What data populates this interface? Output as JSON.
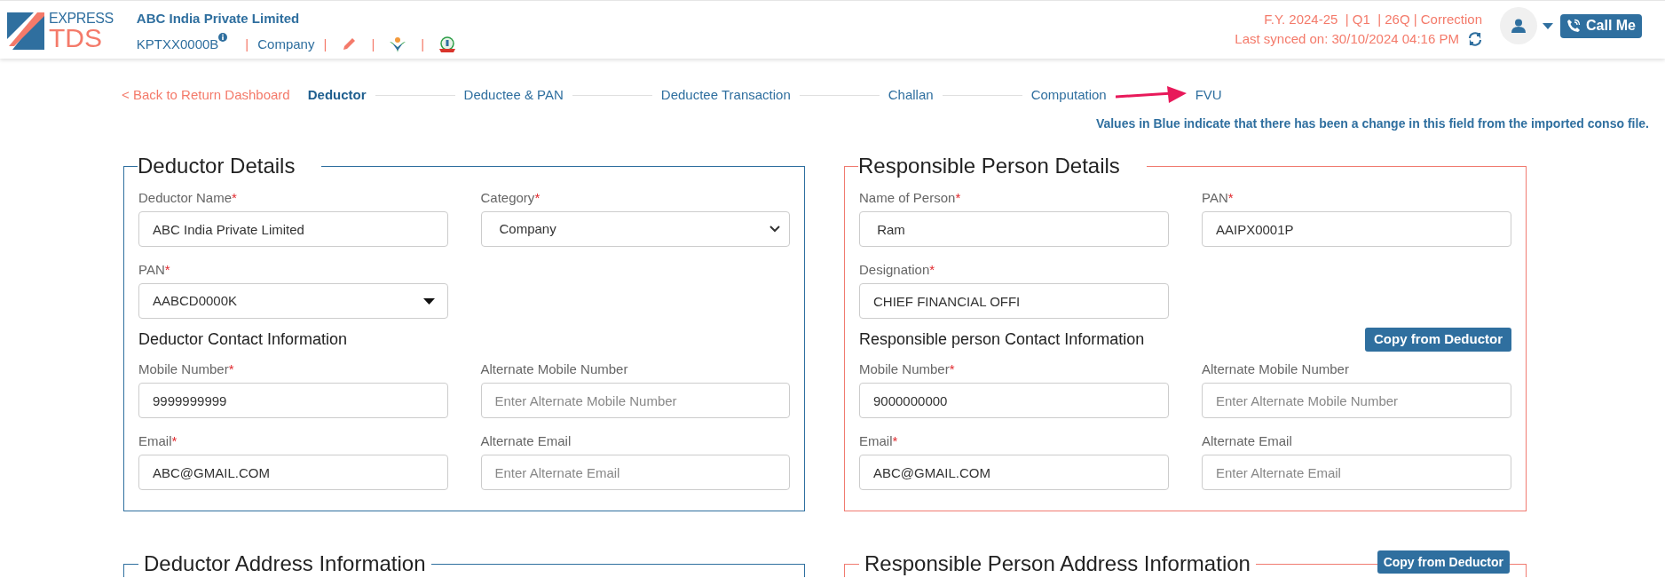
{
  "header": {
    "logo": {
      "line1": "EXPRESS",
      "line2": "TDS"
    },
    "company_name": "ABC India Private Limited",
    "meta_items": [
      {
        "kind": "tan",
        "text": "KPTXX0000B"
      },
      {
        "kind": "separator",
        "text": "|"
      },
      {
        "kind": "label",
        "text": "Company"
      },
      {
        "kind": "separator",
        "text": "|"
      },
      {
        "kind": "edit"
      },
      {
        "kind": "separator",
        "text": "|"
      },
      {
        "kind": "emblem"
      },
      {
        "kind": "separator",
        "text": "|"
      },
      {
        "kind": "seal"
      }
    ],
    "return_info": "F.Y. 2024-25  | Q1  | 26Q | Correction",
    "last_synced": "Last synced on: 30/10/2024 04:16 PM",
    "call_button": "Call Me"
  },
  "back_link": "< Back to Return Dashboard",
  "steps": [
    {
      "label": "Deductor",
      "selected": true
    },
    {
      "label": "Deductee & PAN",
      "selected": false
    },
    {
      "label": "Deductee Transaction",
      "selected": false
    },
    {
      "label": "Challan",
      "selected": false
    },
    {
      "label": "Computation",
      "selected": false
    },
    {
      "label": "FVU",
      "selected": false
    }
  ],
  "note": "Values in Blue indicate that there has been a change in this field from the imported conso file.",
  "sections": [
    {
      "title": "Deductor Details",
      "kind": "deductor",
      "items": [
        {
          "kind": "fields",
          "fields": [
            {
              "label": "Deductor Name",
              "required_mark": "*",
              "kind": "text",
              "value": "ABC India Private Limited"
            },
            {
              "label": "Category",
              "required_mark": "*",
              "kind": "select",
              "value": "Company"
            }
          ]
        },
        {
          "kind": "fields",
          "fields": [
            {
              "label": "PAN",
              "required_mark": "*",
              "kind": "dropdown",
              "value": "AABCD0000K"
            }
          ]
        },
        {
          "kind": "heading",
          "text": "Deductor Contact Information"
        },
        {
          "kind": "fields",
          "fields": [
            {
              "label": "Mobile Number",
              "required_mark": "*",
              "kind": "text",
              "value": "9999999999"
            },
            {
              "label": "Alternate Mobile Number",
              "kind": "text",
              "placeholder": "Enter Alternate Mobile Number"
            }
          ]
        },
        {
          "kind": "fields",
          "fields": [
            {
              "label": "Email",
              "required_mark": "*",
              "kind": "text",
              "value": "ABC@GMAIL.COM"
            },
            {
              "label": "Alternate Email",
              "kind": "text",
              "placeholder": "Enter Alternate Email"
            }
          ]
        }
      ]
    },
    {
      "title": "Responsible Person Details",
      "kind": "responsible",
      "items": [
        {
          "kind": "fields",
          "fields": [
            {
              "label": "Name of Person",
              "required_mark": "*",
              "kind": "text",
              "value": " Ram"
            },
            {
              "label": "PAN",
              "required_mark": "*",
              "kind": "text",
              "value": "AAIPX0001P"
            }
          ]
        },
        {
          "kind": "fields",
          "fields": [
            {
              "label": "Designation",
              "required_mark": "*",
              "kind": "text",
              "value": "CHIEF FINANCIAL OFFI"
            }
          ]
        },
        {
          "kind": "heading",
          "text": "Responsible person Contact Information",
          "button": "Copy from Deductor"
        },
        {
          "kind": "fields",
          "fields": [
            {
              "label": "Mobile Number",
              "required_mark": "*",
              "kind": "text",
              "value": "9000000000"
            },
            {
              "label": "Alternate Mobile Number",
              "kind": "text",
              "placeholder": "Enter Alternate Mobile Number"
            }
          ]
        },
        {
          "kind": "fields",
          "fields": [
            {
              "label": "Email",
              "required_mark": "*",
              "kind": "text",
              "value": "ABC@GMAIL.COM"
            },
            {
              "label": "Alternate Email",
              "kind": "text",
              "placeholder": "Enter Alternate Email"
            }
          ]
        }
      ]
    }
  ],
  "address_sections": [
    {
      "title": "Deductor Address Information",
      "kind": "deductor"
    },
    {
      "title": "Responsible Person Address Information",
      "kind": "responsible",
      "button": "Copy from Deductor"
    }
  ]
}
